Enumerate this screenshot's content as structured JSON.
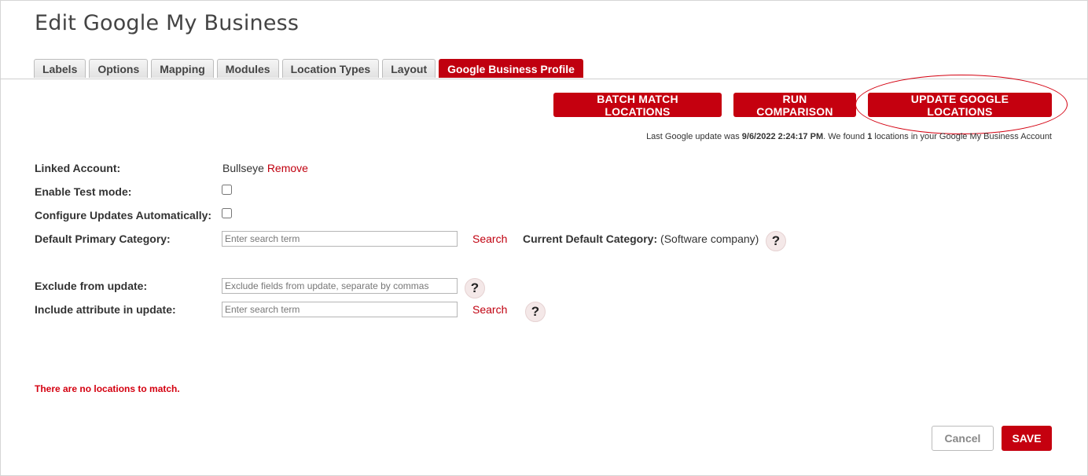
{
  "page": {
    "title": "Edit Google My Business"
  },
  "tabs": [
    {
      "label": "Labels"
    },
    {
      "label": "Options"
    },
    {
      "label": "Mapping"
    },
    {
      "label": "Modules"
    },
    {
      "label": "Location Types"
    },
    {
      "label": "Layout"
    },
    {
      "label": "Google Business Profile",
      "active": true
    }
  ],
  "actions": {
    "batch_match": "BATCH MATCH LOCATIONS",
    "run_comparison": "RUN COMPARISON",
    "update_google": "UPDATE GOOGLE LOCATIONS"
  },
  "status": {
    "prefix": "Last Google update was ",
    "date": "9/6/2022 2:24:17 PM",
    "middle": ". We found ",
    "count": "1",
    "suffix": " locations in your Google My Business Account"
  },
  "form": {
    "linked_account_label": "Linked Account:",
    "linked_account_value": "Bullseye",
    "remove_link": "Remove",
    "test_mode_label": "Enable Test mode:",
    "test_mode_checked": false,
    "auto_updates_label": "Configure Updates Automatically:",
    "auto_updates_checked": false,
    "primary_category_label": "Default Primary Category:",
    "primary_category_placeholder": "Enter search term",
    "primary_category_search": "Search",
    "current_category_label": "Current Default Category:",
    "current_category_value": "(Software company)",
    "exclude_label": "Exclude from update:",
    "exclude_placeholder": "Exclude fields from update, separate by commas",
    "include_label": "Include attribute in update:",
    "include_placeholder": "Enter search term",
    "include_search": "Search",
    "help_glyph": "?"
  },
  "messages": {
    "no_locations": "There are no locations to match."
  },
  "footer": {
    "cancel": "Cancel",
    "save": "SAVE"
  },
  "colors": {
    "brand_red": "#c5000f",
    "warning_red": "#d40010"
  }
}
